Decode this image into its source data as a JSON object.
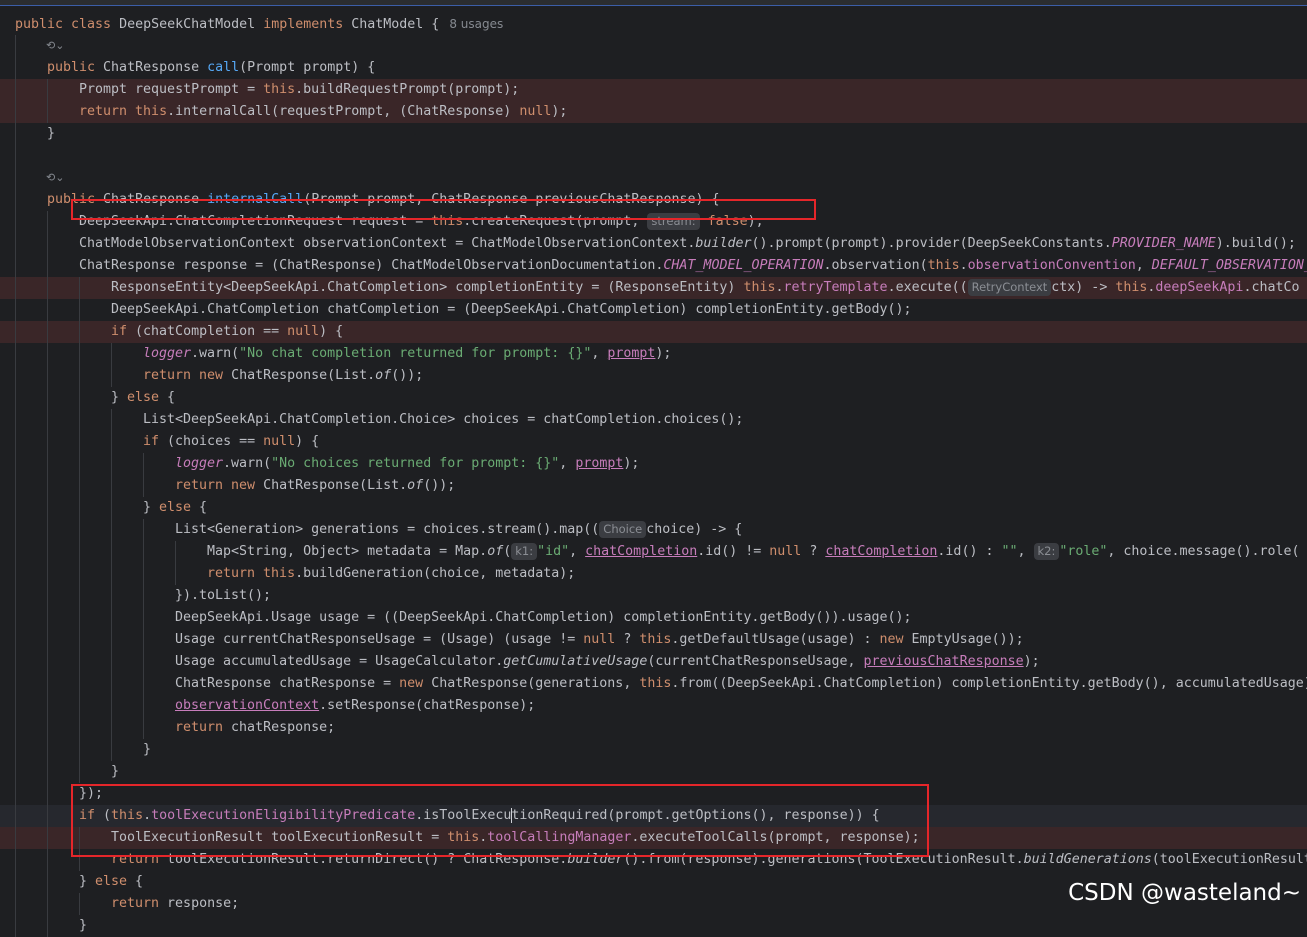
{
  "class_decl": {
    "keywords1": "public class ",
    "class_name": "DeepSeekChatModel ",
    "keyword_impl": "implements ",
    "interface_name": "ChatModel {",
    "usages": "8 usages"
  },
  "lens_glyph": "⟲⌄",
  "hints": {
    "stream": "stream:",
    "retry_context": "RetryContext",
    "choice": "Choice",
    "k1": "k1:",
    "k2": "k2:"
  },
  "code": {
    "call_sig": {
      "a": "public ",
      "b": "ChatResponse ",
      "c": "call",
      "d": "(Prompt prompt) {"
    },
    "l_request_prompt": {
      "a": "Prompt requestPrompt = ",
      "b": "this",
      "c": ".buildRequestPrompt(prompt);"
    },
    "l_return_internal": {
      "a": "return ",
      "b": "this",
      "c": ".internalCall(requestPrompt, (ChatResponse) ",
      "d": "null",
      "e": ");"
    },
    "close_brace": "}",
    "internal_sig": {
      "a": "public ",
      "b": "ChatResponse ",
      "c": "internalCall",
      "d": "(Prompt prompt, ChatResponse previousChatResponse) {"
    },
    "l_create_request": {
      "a": "DeepSeekApi.ChatCompletionRequest request = ",
      "b": "this",
      "c": ".createRequest(prompt, ",
      "d": "false",
      "e": ");"
    },
    "l_obs_context": {
      "a": "ChatModelObservationContext observationContext = ChatModelObservationContext.",
      "b": "builder",
      "c": "().prompt(prompt).provider(DeepSeekConstants.",
      "d": "PROVIDER_NAME",
      "e": ").build();"
    },
    "l_response": {
      "a": "ChatResponse response = (ChatResponse) ChatModelObservationDocumentation.",
      "b": "CHAT_MODEL_OPERATION",
      "c": ".observation(",
      "d": "this",
      "e": ".",
      "f": "observationConvention",
      "g": ", ",
      "h": "DEFAULT_OBSERVATION_"
    },
    "l_completion_entity": {
      "a": "ResponseEntity<DeepSeekApi.ChatCompletion> completionEntity = (ResponseEntity) ",
      "b": "this",
      "c": ".",
      "d": "retryTemplate",
      "e": ".execute((",
      "f": "ctx) -> ",
      "g": "this",
      "h": ".",
      "i": "deepSeekApi",
      "j": ".chatCo"
    },
    "l_chat_completion": "DeepSeekApi.ChatCompletion chatCompletion = (DeepSeekApi.ChatCompletion) completionEntity.getBody();",
    "l_if_null": {
      "a": "if ",
      "b": "(chatCompletion == ",
      "c": "null",
      "d": ") {"
    },
    "l_warn1": {
      "a": "logger",
      "b": ".warn(",
      "c": "\"No chat completion returned for prompt: {}\"",
      "d": ", ",
      "e": "prompt",
      "f": ");"
    },
    "l_return_empty": {
      "a": "return new ",
      "b": "ChatResponse(List.",
      "c": "of",
      "d": "());"
    },
    "l_else": {
      "a": "} ",
      "b": "else ",
      "c": "{"
    },
    "l_choices": "List<DeepSeekApi.ChatCompletion.Choice> choices = chatCompletion.choices();",
    "l_if_choices": {
      "a": "if ",
      "b": "(choices == ",
      "c": "null",
      "d": ") {"
    },
    "l_warn2": {
      "a": "logger",
      "b": ".warn(",
      "c": "\"No choices returned for prompt: {}\"",
      "d": ", ",
      "e": "prompt",
      "f": ");"
    },
    "l_generations": {
      "a": "List<Generation> generations = choices.stream().map((",
      "b": "choice) -> {"
    },
    "l_metadata": {
      "a": "Map<String, Object> metadata = Map.",
      "b": "of",
      "c": "(",
      "d": "\"id\"",
      "e": ", ",
      "f": "chatCompletion",
      "g": ".id() != ",
      "h": "null",
      "i": " ? ",
      "j": ".id() : ",
      "k": "\"\"",
      "l": ", ",
      "m": "\"role\"",
      "n": ", choice.message().role("
    },
    "l_return_build": {
      "a": "return ",
      "b": "this",
      "c": ".buildGeneration(choice, metadata);"
    },
    "l_tolist": "}).toList();",
    "l_usage": "DeepSeekApi.Usage usage = ((DeepSeekApi.ChatCompletion) completionEntity.getBody()).usage();",
    "l_current_usage": {
      "a": "Usage currentChatResponseUsage = (Usage) (usage != ",
      "b": "null",
      "c": " ? ",
      "d": "this",
      "e": ".getDefaultUsage(usage) : ",
      "f": "new ",
      "g": "EmptyUsage());"
    },
    "l_accum_usage": {
      "a": "Usage accumulatedUsage = UsageCalculator.",
      "b": "getCumulativeUsage",
      "c": "(currentChatResponseUsage, ",
      "d": "previousChatResponse",
      "e": ");"
    },
    "l_chat_response": {
      "a": "ChatResponse chatResponse = ",
      "b": "new ",
      "c": "ChatResponse(generations, ",
      "d": "this",
      "e": ".from((DeepSeekApi.ChatCompletion) completionEntity.getBody(), accumulatedUsage)"
    },
    "l_set_response": {
      "a": "observationContext",
      "b": ".setResponse(chatResponse);"
    },
    "l_return_cr": {
      "a": "return ",
      "b": "chatResponse;"
    },
    "l_close_paren": "});",
    "l_if_tool": {
      "a": "if ",
      "b": "(",
      "c": "this",
      "d": ".",
      "e": "toolExecutionEligibilityPredicate",
      "f": ".isToolExecu",
      "g": "tionRequired(prompt.getOptions(), response)) {"
    },
    "l_tool_result": {
      "a": "ToolExecutionResult toolExecutionResult = ",
      "b": "this",
      "c": ".",
      "d": "toolCallingManager",
      "e": ".executeToolCalls(prompt, response);"
    },
    "l_return_direct": {
      "a": "return ",
      "b": "toolExecutionResult.returnDirect() ? ChatResponse.",
      "c": "builder",
      "d": "().from(response).generations(ToolExecutionResult.",
      "e": "buildGenerations",
      "f": "(toolExecutionResult"
    },
    "l_else2": {
      "a": "} ",
      "b": "else ",
      "c": "{"
    },
    "l_return_response": {
      "a": "return ",
      "b": "response;"
    },
    "l_last_brace": "}"
  },
  "watermark": "CSDN @wasteland~"
}
